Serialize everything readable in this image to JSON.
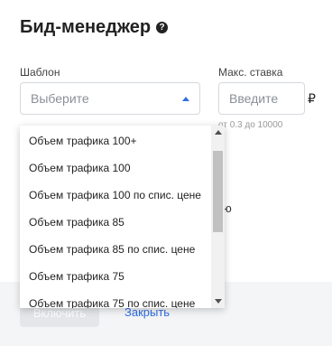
{
  "header": {
    "title": "Бид-менеджер",
    "help_icon": "?"
  },
  "form": {
    "template_label": "Шаблон",
    "template_placeholder": "Выберите",
    "max_bid_label": "Макс. ставка",
    "max_bid_placeholder": "Введите",
    "currency": "₽",
    "max_bid_hint": "от 0.3 до 10000"
  },
  "dropdown": {
    "options": [
      "Объем трафика 100+",
      "Объем трафика 100",
      "Объем трафика 100 по спис. цене",
      "Объем трафика 85",
      "Объем трафика 85 по спис. цене",
      "Объем трафика 75",
      "Объем трафика 75 по спис. цене"
    ]
  },
  "background": {
    "partial_text": "ю"
  },
  "actions": {
    "enable_label": "Включить",
    "close_label": "Закрыть"
  },
  "colors": {
    "accent": "#2f6fe4",
    "placeholder": "#8a8f97",
    "border": "#d5d8dd"
  }
}
